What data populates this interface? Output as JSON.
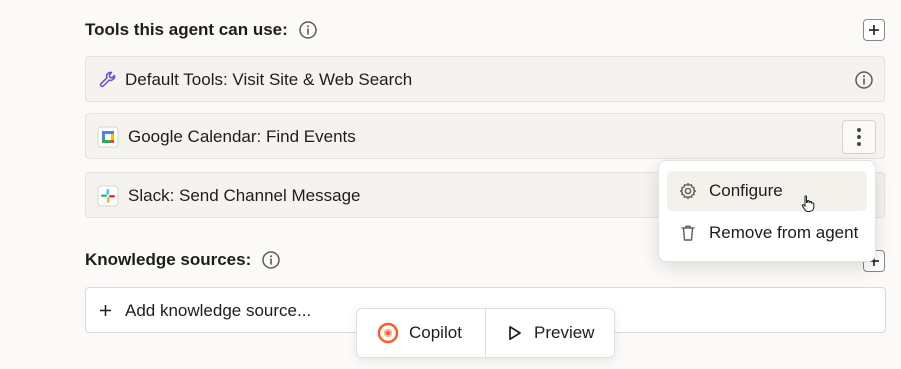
{
  "tools_section": {
    "title": "Tools this agent can use:",
    "items": [
      {
        "label": "Default Tools: Visit Site & Web Search",
        "icon": "wrench-icon"
      },
      {
        "label": "Google Calendar: Find Events",
        "icon": "google-calendar-icon"
      },
      {
        "label": "Slack: Send Channel Message",
        "icon": "slack-icon"
      }
    ]
  },
  "knowledge_section": {
    "title": "Knowledge sources:",
    "add_label": "Add knowledge source..."
  },
  "context_menu": {
    "items": [
      {
        "label": "Configure",
        "icon": "gear-icon"
      },
      {
        "label": "Remove from agent",
        "icon": "trash-icon"
      }
    ]
  },
  "bottom_bar": {
    "copilot_label": "Copilot",
    "preview_label": "Preview"
  },
  "colors": {
    "accent_purple": "#6c4ad6",
    "copilot_orange": "#ff5a1f"
  }
}
